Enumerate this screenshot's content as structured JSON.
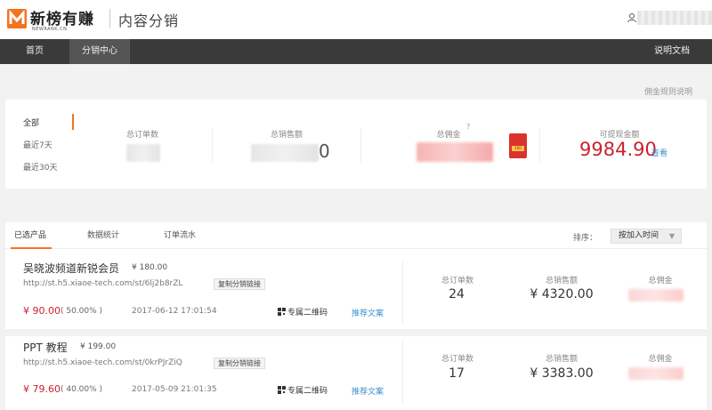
{
  "header": {
    "brand": "新榜有赚",
    "brand_sub": "NEWRANK.CN",
    "product": "内容分销"
  },
  "nav": {
    "items": [
      "首页",
      "分销中心"
    ],
    "docs": "说明文档"
  },
  "rules_link": "佣金规则说明",
  "summary": {
    "filters": [
      "全部",
      "最近7天",
      "最近30天"
    ],
    "labels": {
      "orders": "总订单数",
      "sales": "总销售额",
      "commission": "总佣金",
      "withdrawable": "可提现金额"
    },
    "sales_tail": "0",
    "help_mark": "?",
    "redpack_text": "100",
    "withdrawable_value": "9984.90",
    "view_link": "查看"
  },
  "tabs": {
    "items": [
      "已选产品",
      "数据统计",
      "订单流水"
    ],
    "sort_label": "排序：",
    "sort_value": "按加入时间",
    "sort_arrow": "▼"
  },
  "products": [
    {
      "name": "吴晓波频道新锐会员",
      "price": "¥ 180.00",
      "url": "http://st.h5.xiaoe-tech.com/st/6lj2b8rZL",
      "copy": "复制分销链接",
      "commission": "¥ 90.00",
      "pct": "( 50.00% )",
      "date": "2017-06-12 17:01:54",
      "qr": "专属二维码",
      "rec": "推荐文案",
      "orders_label": "总订单数",
      "orders": "24",
      "sales_label": "总销售额",
      "sales": "¥ 4320.00",
      "commission_label": "总佣金"
    },
    {
      "name": "PPT 教程",
      "price": "¥ 199.00",
      "url": "http://st.h5.xiaoe-tech.com/st/0krPJrZiQ",
      "copy": "复制分销链接",
      "commission": "¥ 79.60",
      "pct": "( 40.00% )",
      "date": "2017-05-09 21:01:35",
      "qr": "专属二维码",
      "rec": "推荐文案",
      "orders_label": "总订单数",
      "orders": "17",
      "sales_label": "总销售额",
      "sales": "¥ 3383.00",
      "commission_label": "总佣金"
    }
  ],
  "colors": {
    "brand": "#f47321",
    "price_red": "#c8232c",
    "link_blue": "#3d8fcf",
    "nav_bg": "#3a3a3a"
  }
}
